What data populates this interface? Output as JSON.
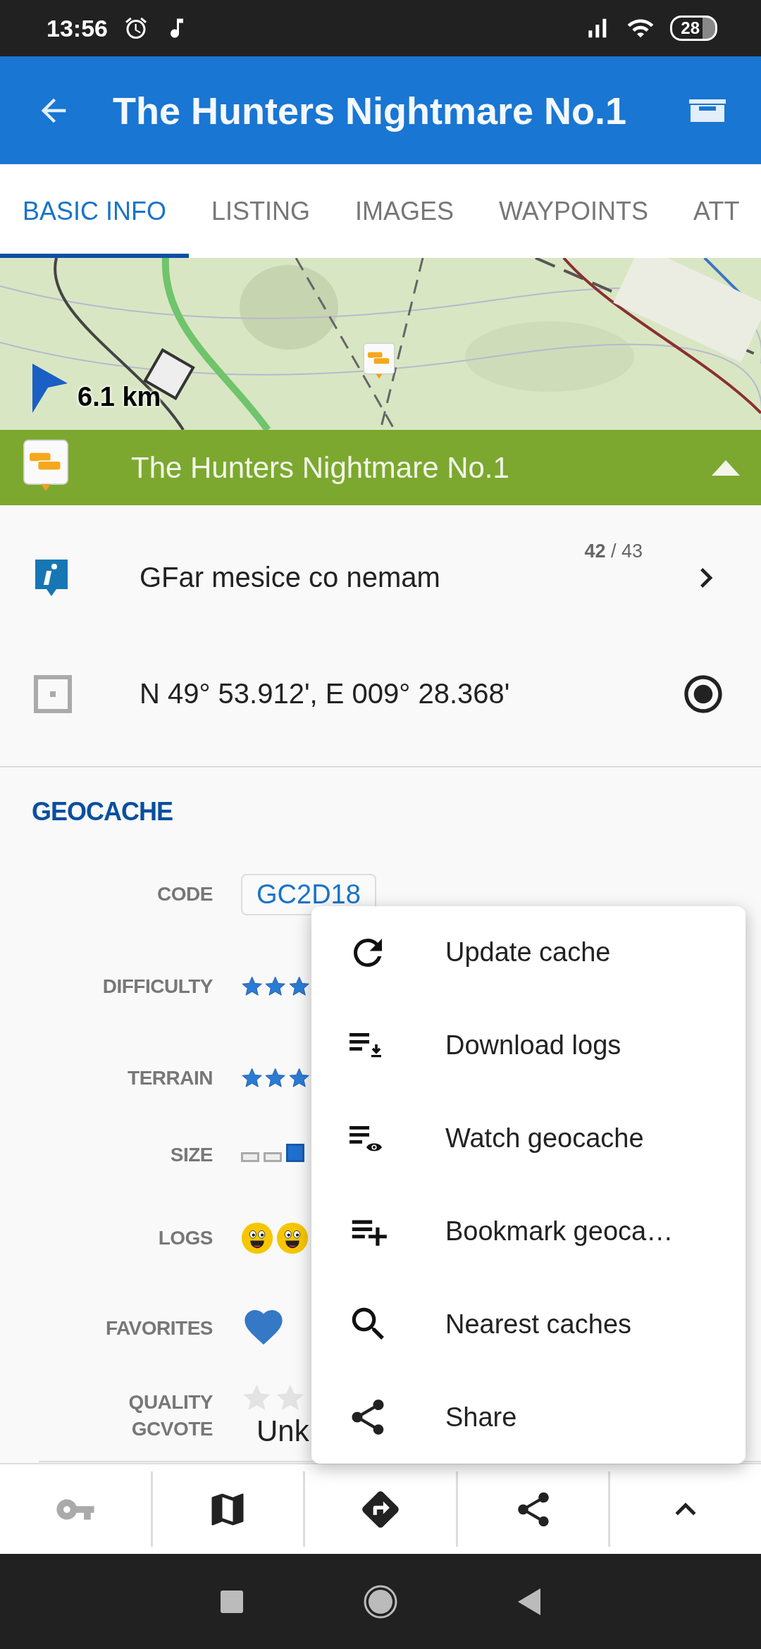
{
  "status_bar": {
    "time": "13:56",
    "battery": "28"
  },
  "app_bar": {
    "title": "The Hunters Nightmare No.1"
  },
  "tabs": [
    {
      "label": "BASIC INFO",
      "selected": true
    },
    {
      "label": "LISTING",
      "selected": false
    },
    {
      "label": "IMAGES",
      "selected": false
    },
    {
      "label": "WAYPOINTS",
      "selected": false
    },
    {
      "label": "ATT",
      "selected": false
    }
  ],
  "map": {
    "kind": "picture",
    "distance": "6.1 km"
  },
  "cache_bar": {
    "title": "The Hunters Nightmare No.1",
    "expanded": true
  },
  "info_rows": [
    {
      "kind": "info",
      "text": "GFar mesice co nemam",
      "counter": "**42** / 43"
    },
    {
      "kind": "coords",
      "text": "N 49° 53.912', E 009° 28.368'"
    }
  ],
  "section": {
    "title": "GEOCACHE"
  },
  "details": [
    {
      "kind": "code",
      "label": "CODE",
      "value": "GC2D18"
    },
    {
      "kind": "stars",
      "label": "DIFFICULTY",
      "stars": 3
    },
    {
      "kind": "stars",
      "label": "TERRAIN",
      "stars": 3
    },
    {
      "kind": "size",
      "label": "SIZE",
      "boxes": [
        {
          "selected": false
        },
        {
          "selected": false
        },
        {
          "selected": true
        }
      ]
    },
    {
      "kind": "logs",
      "label": "LOGS"
    },
    {
      "kind": "favorites",
      "label": "FAVORITES"
    },
    {
      "kind": "gcvote",
      "label": "QUALITY\nGCVOTE",
      "value": "Unk"
    }
  ],
  "menu": [
    {
      "kind": "refresh",
      "label": "Update cache"
    },
    {
      "kind": "download",
      "label": "Download logs"
    },
    {
      "kind": "watch",
      "label": "Watch geocache"
    },
    {
      "kind": "bookmark",
      "label": "Bookmark geoca…"
    },
    {
      "kind": "search",
      "label": "Nearest caches"
    },
    {
      "kind": "share",
      "label": "Share"
    }
  ],
  "bottom_bar": [
    {
      "kind": "key",
      "disabled": true
    },
    {
      "kind": "map",
      "disabled": false
    },
    {
      "kind": "directions",
      "disabled": false
    },
    {
      "kind": "share",
      "disabled": false
    },
    {
      "kind": "expand",
      "disabled": false
    }
  ]
}
